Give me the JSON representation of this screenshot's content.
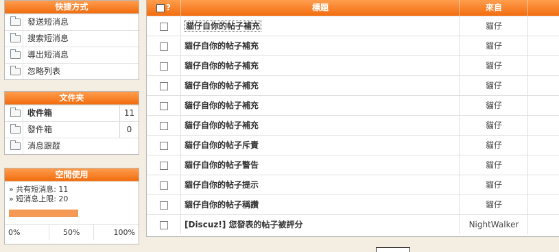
{
  "shortcuts": {
    "title": "快捷方式",
    "items": [
      {
        "label": "發送短消息",
        "icon": "folder-icon"
      },
      {
        "label": "搜索短消息",
        "icon": "folder-icon"
      },
      {
        "label": "導出短消息",
        "icon": "folder-icon"
      },
      {
        "label": "忽略列表",
        "icon": "folder-icon"
      }
    ]
  },
  "folders": {
    "title": "文件夹",
    "items": [
      {
        "label": "收件箱",
        "count": "11"
      },
      {
        "label": "發件箱",
        "count": "0"
      },
      {
        "label": "消息跟蹤"
      }
    ]
  },
  "space": {
    "title": "空間使用",
    "total": "» 共有短消息: 11",
    "limit": "» 短消息上限: 20",
    "usage_fraction": 0.55,
    "bar_color": "#f59a55",
    "scale": [
      "0%",
      "50%",
      "100%"
    ]
  },
  "table": {
    "header": {
      "check_label": "?",
      "title": "標題",
      "from": "來自"
    },
    "rows": [
      {
        "title": "貓仔自你的帖子補充",
        "from": "貓仔"
      },
      {
        "title": "貓仔自你的帖子補充",
        "from": "貓仔"
      },
      {
        "title": "貓仔自你的帖子補充",
        "from": "貓仔"
      },
      {
        "title": "貓仔自你的帖子補充",
        "from": "貓仔"
      },
      {
        "title": "貓仔自你的帖子補充",
        "from": "貓仔"
      },
      {
        "title": "貓仔自你的帖子補充",
        "from": "貓仔"
      },
      {
        "title": "貓仔自你的帖子斥責",
        "from": "貓仔"
      },
      {
        "title": "貓仔自你的帖子警告",
        "from": "貓仔"
      },
      {
        "title": "貓仔自你的帖子提示",
        "from": "貓仔"
      },
      {
        "title": "貓仔自你的帖子稱讚",
        "from": "貓仔"
      },
      {
        "title": "[Discuz!] 您發表的帖子被評分",
        "from": "NightWalker"
      }
    ]
  },
  "colors": {
    "accent": "#f26d0f",
    "page_bg": "#f3eee1"
  }
}
